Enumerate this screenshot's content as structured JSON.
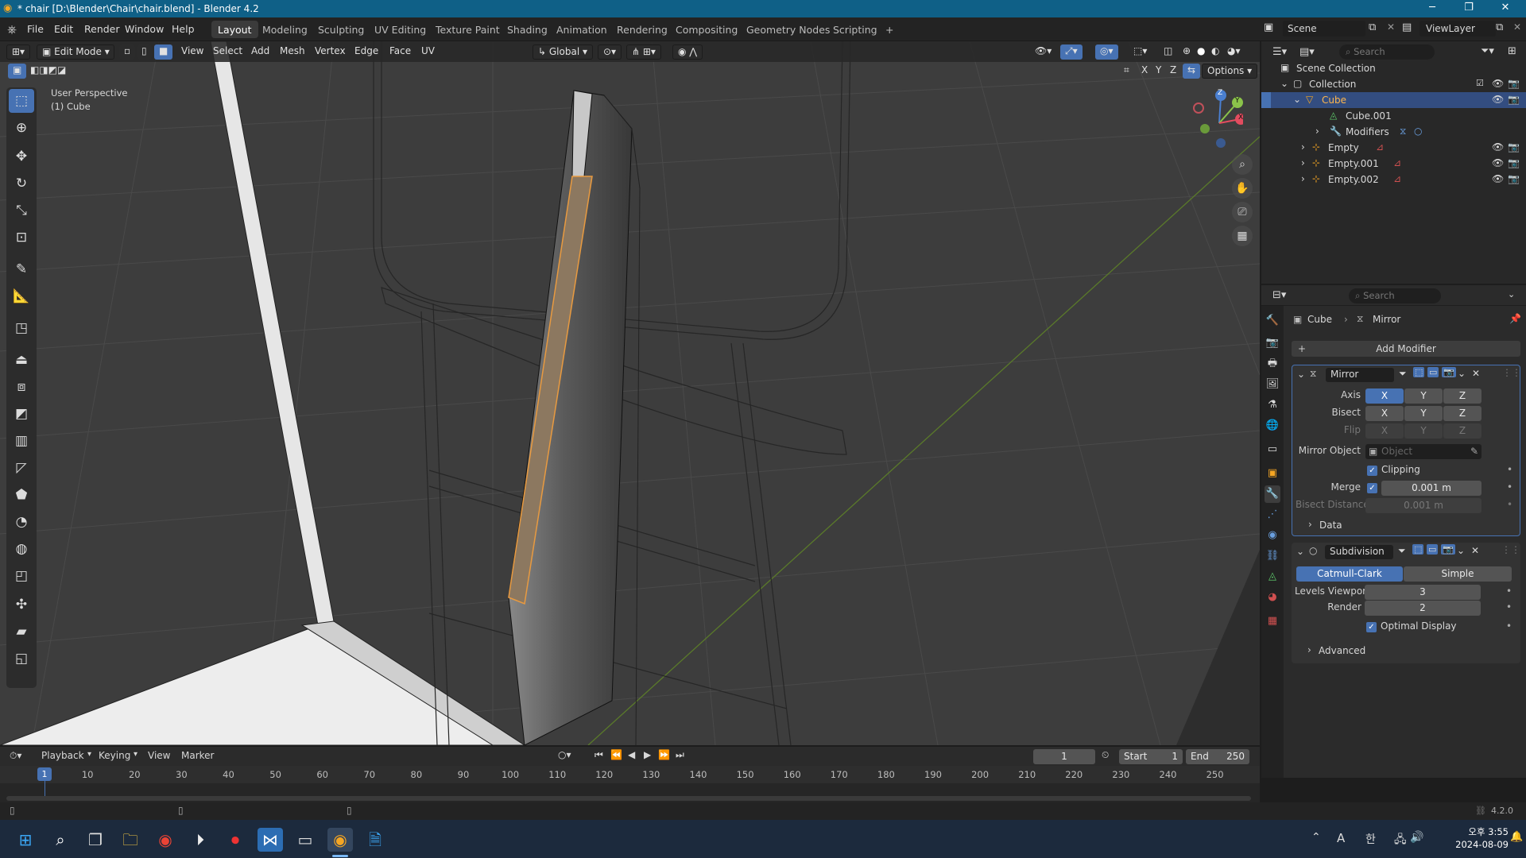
{
  "window": {
    "title": "* chair [D:\\Blender\\Chair\\chair.blend] - Blender 4.2"
  },
  "menu": [
    "File",
    "Edit",
    "Render",
    "Window",
    "Help"
  ],
  "workspaces": [
    "Layout",
    "Modeling",
    "Sculpting",
    "UV Editing",
    "Texture Paint",
    "Shading",
    "Animation",
    "Rendering",
    "Compositing",
    "Geometry Nodes",
    "Scripting",
    "+"
  ],
  "scene": {
    "scene_name": "Scene",
    "view_layer": "ViewLayer"
  },
  "viewport_header": {
    "mode": "Edit Mode",
    "menus": [
      "View",
      "Select",
      "Add",
      "Mesh",
      "Vertex",
      "Edge",
      "Face",
      "UV"
    ],
    "orientation": "Global",
    "options": "Options",
    "axes": [
      "X",
      "Y",
      "Z"
    ]
  },
  "viewport": {
    "perspective": "User Perspective",
    "object": "(1) Cube",
    "gizmo": {
      "x": "X",
      "y": "Y",
      "z": "Z"
    }
  },
  "outliner": {
    "search_placeholder": "Search",
    "rows": [
      {
        "label": "Scene Collection"
      },
      {
        "label": "Collection"
      },
      {
        "label": "Cube"
      },
      {
        "label": "Cube.001"
      },
      {
        "label": "Modifiers"
      },
      {
        "label": "Empty"
      },
      {
        "label": "Empty.001"
      },
      {
        "label": "Empty.002"
      }
    ]
  },
  "properties": {
    "search_placeholder": "Search",
    "breadcrumb_object": "Cube",
    "breadcrumb_modifier": "Mirror",
    "add_modifier": "Add Modifier",
    "mirror": {
      "name": "Mirror",
      "axis_label": "Axis",
      "bisect_label": "Bisect",
      "flip_label": "Flip",
      "x": "X",
      "y": "Y",
      "z": "Z",
      "mirror_object_label": "Mirror Object",
      "mirror_object_placeholder": "Object",
      "clipping_label": "Clipping",
      "merge_label": "Merge",
      "merge_value": "0.001 m",
      "bisect_distance_label": "Bisect Distance",
      "bisect_distance_value": "0.001 m",
      "data_label": "Data"
    },
    "subdivision": {
      "name": "Subdivision",
      "catmull": "Catmull-Clark",
      "simple": "Simple",
      "levels_viewport_label": "Levels Viewport",
      "levels_viewport_value": "3",
      "render_label": "Render",
      "render_value": "2",
      "optimal_label": "Optimal Display",
      "advanced_label": "Advanced"
    }
  },
  "timeline": {
    "menus": [
      "Playback",
      "Keying",
      "View",
      "Marker"
    ],
    "current_frame": "1",
    "start_label": "Start",
    "start_value": "1",
    "end_label": "End",
    "end_value": "250",
    "ticks": [
      "1",
      "10",
      "20",
      "30",
      "40",
      "50",
      "60",
      "70",
      "80",
      "90",
      "100",
      "110",
      "120",
      "130",
      "140",
      "150",
      "160",
      "170",
      "180",
      "190",
      "200",
      "210",
      "220",
      "230",
      "240",
      "250"
    ]
  },
  "status": {
    "version": "4.2.0"
  },
  "taskbar": {
    "time": "오후 3:55",
    "date": "2024-08-09",
    "ime": "A",
    "lang": "한"
  }
}
